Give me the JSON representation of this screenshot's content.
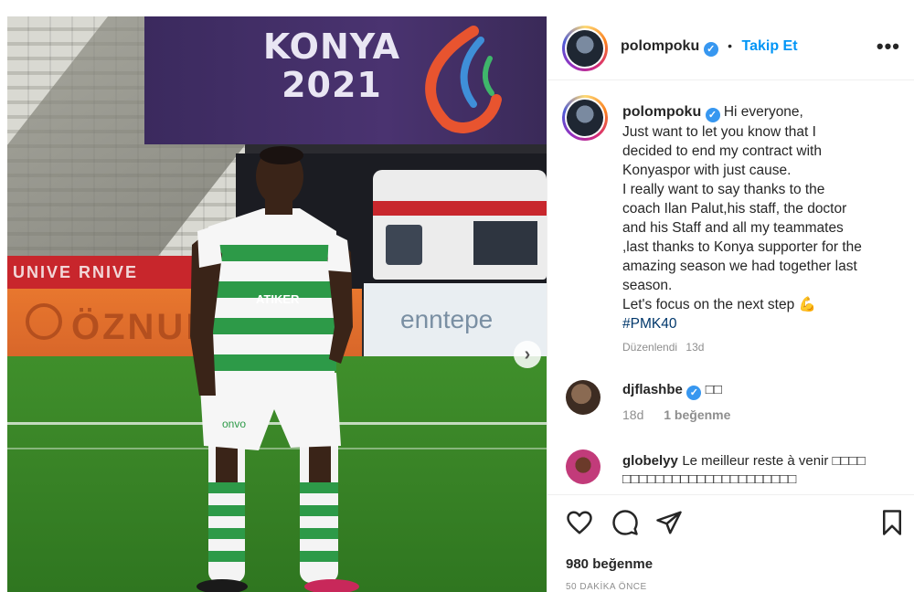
{
  "photo": {
    "banner_line1": "KONYA",
    "banner_line2": "2021",
    "adboard_red_text": "UNIVE RNIVE",
    "adboard_orange_text": "ÖZNUR",
    "adboard_white_text": "enntepe",
    "jersey_sponsor": "ATIKER",
    "shorts_sponsor": "onvo"
  },
  "header": {
    "username": "polompoku",
    "follow_label": "Takip Et",
    "more_label": "•••"
  },
  "caption": {
    "username": "polompoku",
    "lines": [
      "Hi everyone,",
      "Just want to let you know that I",
      "decided to end my contract with",
      "Konyaspor with just cause.",
      "I really want to say thanks to the",
      "coach Ilan Palut,his staff, the doctor",
      "and his Staff and all my teammates",
      ",last thanks to Konya supporter for the",
      "amazing season we had together last",
      "season.",
      "Let's focus on the next step"
    ],
    "emoji": "💪",
    "hashtag": "#PMK40",
    "edited_label": "Düzenlendi",
    "age": "13d"
  },
  "comments": [
    {
      "username": "djflashbe",
      "text": "□□",
      "age": "18d",
      "likes": "1 beğenme",
      "avatar_color": "#4a3a2e"
    },
    {
      "username": "globelyy",
      "text": "Le meilleur reste à venir □□□□",
      "text2": "□□□□□□□□□□□□□□□□□□□□□",
      "avatar_color": "#c23b7a"
    }
  ],
  "footer": {
    "likes": "980 beğenme",
    "time": "50 DAKİKA ÖNCE"
  },
  "colors": {
    "accent": "#0095f6",
    "verified": "#3797f0",
    "hashtag": "#00376b"
  },
  "icons": [
    "heart-icon",
    "comment-icon",
    "share-icon",
    "bookmark-icon",
    "chevron-right-icon",
    "verified-icon",
    "more-icon"
  ]
}
